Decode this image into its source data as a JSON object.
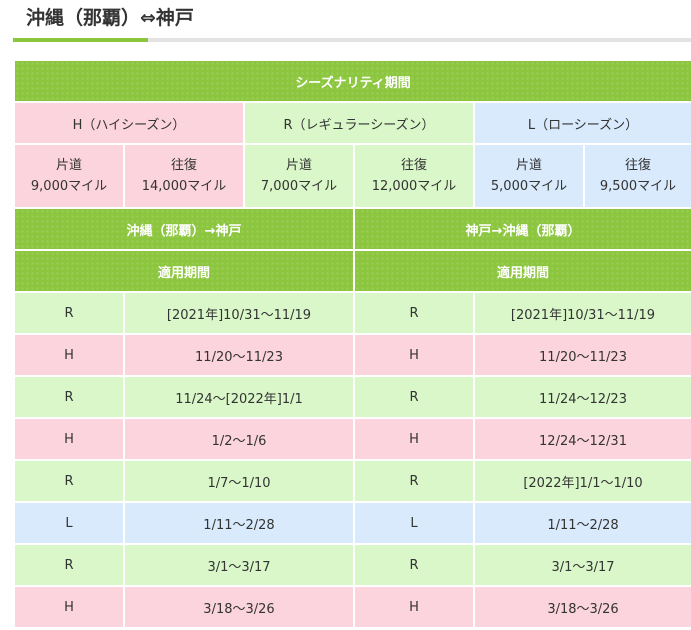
{
  "page": {
    "title": "沖縄（那覇）⇔神戸"
  },
  "season_table": {
    "header": "シーズナリティ期間",
    "tiers": [
      {
        "code": "H",
        "label": "H（ハイシーズン）",
        "oneway_label": "片道",
        "oneway_miles": "9,000マイル",
        "round_label": "往復",
        "round_miles": "14,000マイル"
      },
      {
        "code": "R",
        "label": "R（レギュラーシーズン）",
        "oneway_label": "片道",
        "oneway_miles": "7,000マイル",
        "round_label": "往復",
        "round_miles": "12,000マイル"
      },
      {
        "code": "L",
        "label": "L（ローシーズン）",
        "oneway_label": "片道",
        "oneway_miles": "5,000マイル",
        "round_label": "往復",
        "round_miles": "9,500マイル"
      }
    ],
    "direction_outbound": "沖縄（那覇）→神戸",
    "direction_inbound": "神戸→沖縄（那覇）",
    "period_label_outbound": "適用期間",
    "period_label_inbound": "適用期間",
    "rows": [
      {
        "out_season": "R",
        "out_period": "[2021年]10/31〜11/19",
        "in_season": "R",
        "in_period": "[2021年]10/31〜11/19"
      },
      {
        "out_season": "H",
        "out_period": "11/20〜11/23",
        "in_season": "H",
        "in_period": "11/20〜11/23"
      },
      {
        "out_season": "R",
        "out_period": "11/24〜[2022年]1/1",
        "in_season": "R",
        "in_period": "11/24〜12/23"
      },
      {
        "out_season": "H",
        "out_period": "1/2〜1/6",
        "in_season": "H",
        "in_period": "12/24〜12/31"
      },
      {
        "out_season": "R",
        "out_period": "1/7〜1/10",
        "in_season": "R",
        "in_period": "[2022年]1/1〜1/10"
      },
      {
        "out_season": "L",
        "out_period": "1/11〜2/28",
        "in_season": "L",
        "in_period": "1/11〜2/28"
      },
      {
        "out_season": "R",
        "out_period": "3/1〜3/17",
        "in_season": "R",
        "in_period": "3/1〜3/17"
      },
      {
        "out_season": "H",
        "out_period": "3/18〜3/26",
        "in_season": "H",
        "in_period": "3/18〜3/26"
      }
    ]
  },
  "colors": {
    "header_green": "#8cc63f",
    "high_pink": "#fcd4dd",
    "regular_green": "#d9f7c8",
    "low_blue": "#d8eafc"
  }
}
